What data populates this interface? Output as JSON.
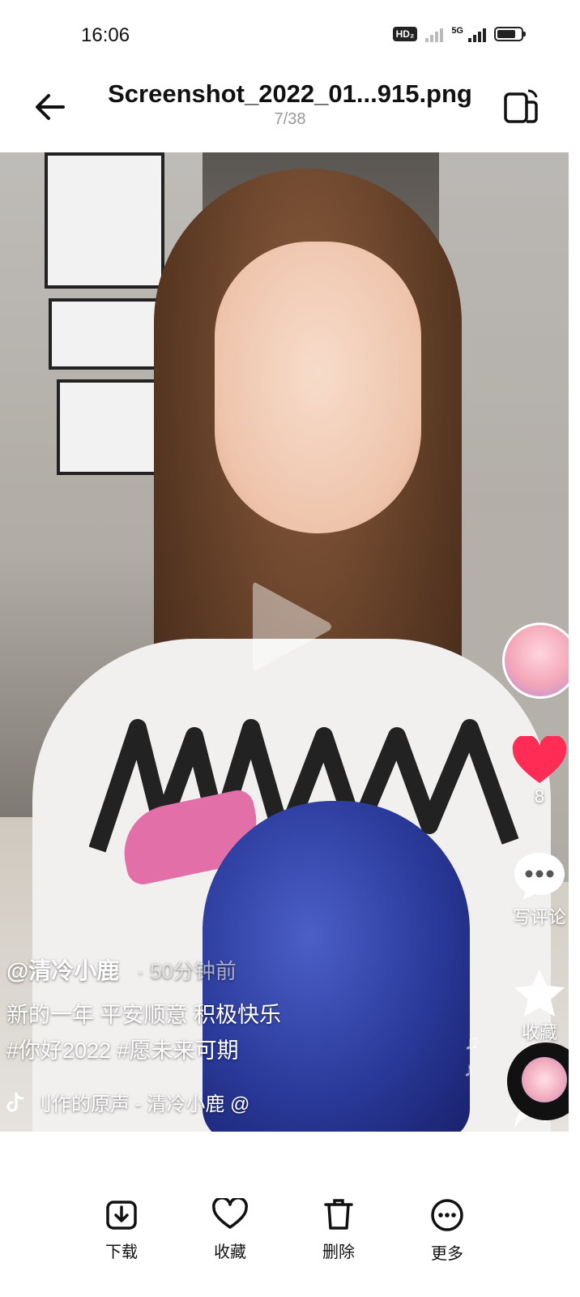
{
  "status_bar": {
    "time": "16:06",
    "hd_badge": "HD₂",
    "network": "5G",
    "battery_level": 0.8
  },
  "header": {
    "title": "Screenshot_2022_01...915.png",
    "counter": "7/38"
  },
  "video": {
    "author": "@清冷小鹿",
    "time_ago": "· 50分钟前",
    "caption_line1": "新的一年 平安顺意 积极快乐",
    "caption_line2": "#你好2022 #愿未来可期",
    "music": "刂作的原声 - 清冷小鹿   @"
  },
  "side_rail": {
    "likes": "8",
    "comment_label": "写评论",
    "favorite_label": "收藏",
    "shares": "1"
  },
  "toolbar": {
    "download_label": "下载",
    "favorite_label": "收藏",
    "delete_label": "删除",
    "more_label": "更多"
  },
  "colors": {
    "like_red": "#ff2d55",
    "text_dark": "#111111",
    "counter_gray": "#999999"
  }
}
